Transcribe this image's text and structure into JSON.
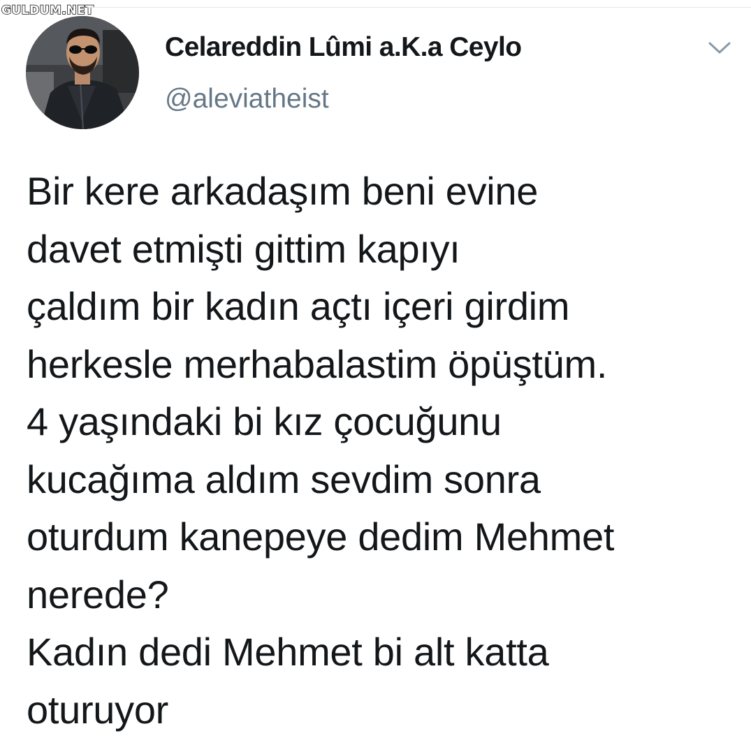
{
  "watermark": "GULDUM.NET",
  "tweet": {
    "display_name": "Celareddin Lûmi a.K.a Ceylo",
    "handle": "@aleviatheist",
    "menu_icon": "chevron-down-icon",
    "lines": [
      "Bir kere arkadaşım beni evine",
      "davet etmişti gittim kapıyı",
      "çaldım bir kadın açtı içeri girdim",
      "herkesle merhabalastim öpüştüm.",
      "4 yaşındaki bi kız çocuğunu",
      "kucağıma aldım sevdim sonra",
      "oturdum kanepeye dedim Mehmet",
      "nerede?",
      "Kadın dedi Mehmet bi alt katta",
      "oturuyor"
    ]
  },
  "colors": {
    "text_primary": "#14171a",
    "text_secondary": "#657786",
    "caret": "#8899a6",
    "background": "#ffffff"
  }
}
